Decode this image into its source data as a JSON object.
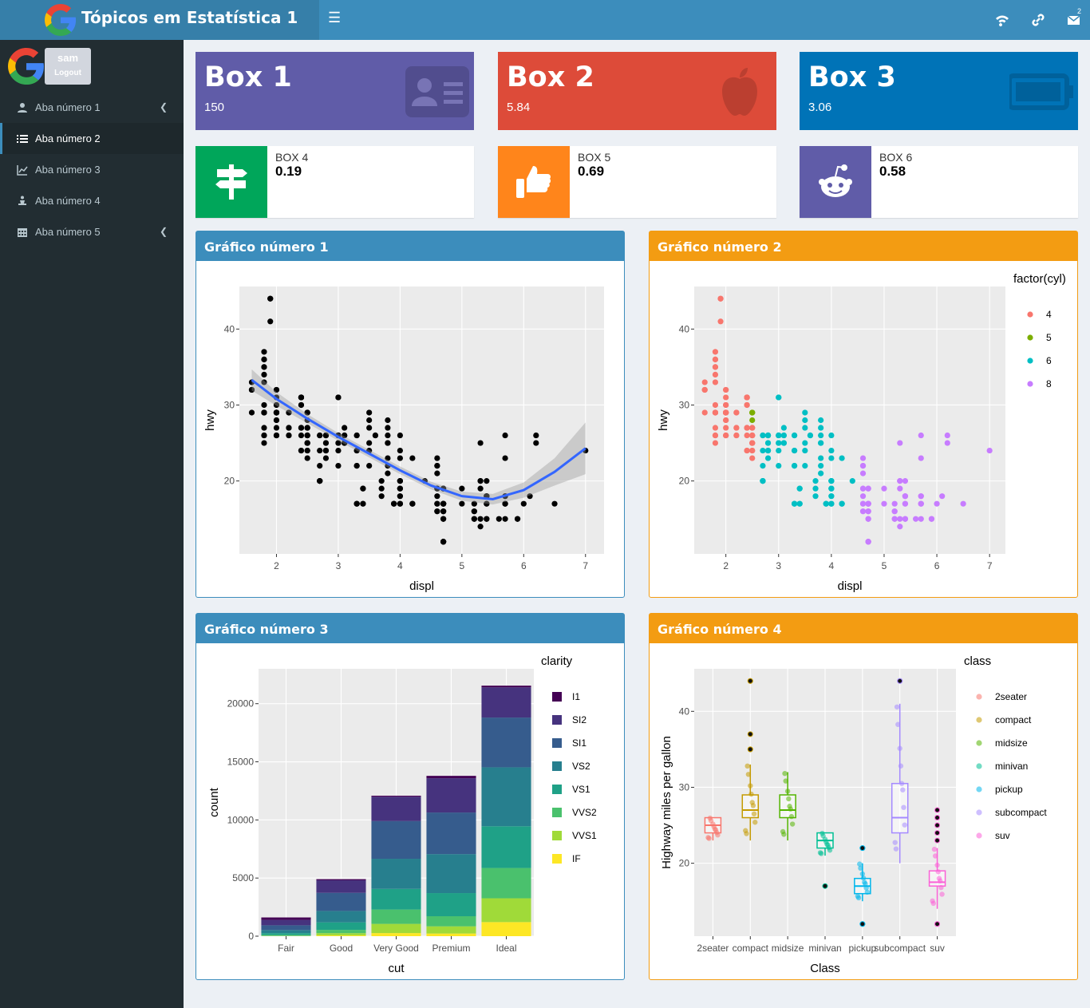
{
  "app": {
    "title": "Tópicos em Estatística 1",
    "notif_count": "2"
  },
  "user": {
    "name": "sam",
    "logout": "Logout"
  },
  "sidebar": {
    "items": [
      {
        "label": "Aba número 1",
        "icon": "user-icon",
        "active": false,
        "chevron": true
      },
      {
        "label": "Aba número 2",
        "icon": "list-icon",
        "active": true,
        "chevron": false
      },
      {
        "label": "Aba número 3",
        "icon": "line-chart-icon",
        "active": false,
        "chevron": false
      },
      {
        "label": "Aba número 4",
        "icon": "meditation-icon",
        "active": false,
        "chevron": false
      },
      {
        "label": "Aba número 5",
        "icon": "calendar-icon",
        "active": false,
        "chevron": true
      }
    ]
  },
  "value_boxes": [
    {
      "title": "Box 1",
      "value": "150",
      "color": "#605ca8",
      "icon": "id-card-icon"
    },
    {
      "title": "Box 2",
      "value": "5.84",
      "color": "#dd4b39",
      "icon": "apple-icon"
    },
    {
      "title": "Box 3",
      "value": "3.06",
      "color": "#0073b7",
      "icon": "battery-icon"
    }
  ],
  "info_boxes": [
    {
      "label": "BOX 4",
      "value": "0.19",
      "color": "#00a65a",
      "icon": "signpost-icon"
    },
    {
      "label": "BOX 5",
      "value": "0.69",
      "color": "#ff851b",
      "icon": "thumbs-up-icon"
    },
    {
      "label": "BOX 6",
      "value": "0.58",
      "color": "#605ca8",
      "icon": "reddit-icon"
    }
  ],
  "panels": [
    {
      "title": "Gráfico número 1"
    },
    {
      "title": "Gráfico número 2"
    },
    {
      "title": "Gráfico número 3"
    },
    {
      "title": "Gráfico número 4"
    }
  ],
  "chart_data": [
    {
      "type": "scatter",
      "xlabel": "displ",
      "ylabel": "hwy",
      "xlim": [
        1.4,
        7.3
      ],
      "ylim": [
        10.4,
        45.6
      ],
      "xticks": [
        2,
        3,
        4,
        5,
        6,
        7
      ],
      "yticks": [
        20,
        30,
        40
      ],
      "grid": true,
      "points": [
        [
          1.8,
          29
        ],
        [
          1.8,
          29
        ],
        [
          2,
          31
        ],
        [
          2,
          30
        ],
        [
          2.8,
          26
        ],
        [
          2.8,
          26
        ],
        [
          3.1,
          27
        ],
        [
          1.8,
          26
        ],
        [
          1.8,
          25
        ],
        [
          2,
          28
        ],
        [
          2,
          27
        ],
        [
          2.8,
          25
        ],
        [
          2.8,
          25
        ],
        [
          3.1,
          25
        ],
        [
          3.1,
          25
        ],
        [
          2.8,
          24
        ],
        [
          3.1,
          25
        ],
        [
          4.2,
          23
        ],
        [
          5.3,
          20
        ],
        [
          5.3,
          15
        ],
        [
          5.3,
          20
        ],
        [
          5.7,
          17
        ],
        [
          6,
          17
        ],
        [
          5.7,
          26
        ],
        [
          5.7,
          23
        ],
        [
          6.2,
          26
        ],
        [
          6.2,
          25
        ],
        [
          7,
          24
        ],
        [
          5.3,
          19
        ],
        [
          5.3,
          14
        ],
        [
          5.7,
          15
        ],
        [
          6.5,
          17
        ],
        [
          2.4,
          27
        ],
        [
          2.4,
          30
        ],
        [
          3.1,
          26
        ],
        [
          3.5,
          29
        ],
        [
          3.6,
          26
        ],
        [
          2.4,
          24
        ],
        [
          3,
          24
        ],
        [
          3.3,
          22
        ],
        [
          3.3,
          22
        ],
        [
          3.3,
          24
        ],
        [
          3.3,
          24
        ],
        [
          3.3,
          17
        ],
        [
          3.8,
          22
        ],
        [
          3.8,
          21
        ],
        [
          3.8,
          23
        ],
        [
          4,
          23
        ],
        [
          3.7,
          19
        ],
        [
          3.7,
          18
        ],
        [
          3.9,
          17
        ],
        [
          3.9,
          17
        ],
        [
          4.7,
          19
        ],
        [
          4.7,
          19
        ],
        [
          4.7,
          12
        ],
        [
          5.2,
          17
        ],
        [
          5.2,
          15
        ],
        [
          3.9,
          17
        ],
        [
          4.7,
          17
        ],
        [
          4.7,
          12
        ],
        [
          4.7,
          17
        ],
        [
          5.2,
          16
        ],
        [
          5.7,
          18
        ],
        [
          5.9,
          15
        ],
        [
          4.7,
          16
        ],
        [
          4.7,
          12
        ],
        [
          4.7,
          17
        ],
        [
          4.7,
          17
        ],
        [
          4.7,
          16
        ],
        [
          4.7,
          12
        ],
        [
          5.2,
          15
        ],
        [
          5.2,
          16
        ],
        [
          5.7,
          17
        ],
        [
          5.9,
          15
        ],
        [
          4.6,
          17
        ],
        [
          5.4,
          17
        ],
        [
          5.4,
          18
        ],
        [
          4,
          17
        ],
        [
          4,
          19
        ],
        [
          4,
          17
        ],
        [
          4,
          19
        ],
        [
          4.6,
          19
        ],
        [
          5,
          17
        ],
        [
          4.2,
          17
        ],
        [
          4.2,
          17
        ],
        [
          4.6,
          16
        ],
        [
          4.6,
          16
        ],
        [
          4.6,
          17
        ],
        [
          5.4,
          15
        ],
        [
          5.4,
          17
        ],
        [
          3.8,
          26
        ],
        [
          3.8,
          25
        ],
        [
          4,
          26
        ],
        [
          4,
          24
        ],
        [
          4.6,
          21
        ],
        [
          4.6,
          22
        ],
        [
          4.6,
          23
        ],
        [
          4.6,
          22
        ],
        [
          5.4,
          20
        ],
        [
          1.6,
          33
        ],
        [
          1.6,
          32
        ],
        [
          1.6,
          32
        ],
        [
          1.6,
          29
        ],
        [
          1.6,
          32
        ],
        [
          1.8,
          34
        ],
        [
          1.8,
          36
        ],
        [
          1.8,
          36
        ],
        [
          2,
          29
        ],
        [
          2.4,
          26
        ],
        [
          2.4,
          27
        ],
        [
          2.4,
          30
        ],
        [
          2.4,
          31
        ],
        [
          2.5,
          26
        ],
        [
          2.5,
          26
        ],
        [
          3.3,
          26
        ],
        [
          2,
          32
        ],
        [
          2,
          30
        ],
        [
          2,
          32
        ],
        [
          2,
          29
        ],
        [
          2.7,
          26
        ],
        [
          2.7,
          24
        ],
        [
          2.7,
          26
        ],
        [
          3,
          22
        ],
        [
          3.7,
          20
        ],
        [
          4,
          17
        ],
        [
          4.7,
          12
        ],
        [
          4.7,
          15
        ],
        [
          4.7,
          16
        ],
        [
          5.7,
          17
        ],
        [
          6.1,
          18
        ],
        [
          4,
          20
        ],
        [
          4.2,
          17
        ],
        [
          4.4,
          20
        ],
        [
          4.6,
          18
        ],
        [
          5.4,
          18
        ],
        [
          5.4,
          15
        ],
        [
          5.4,
          18
        ],
        [
          4,
          20
        ],
        [
          4,
          18
        ],
        [
          4.6,
          19
        ],
        [
          5,
          19
        ],
        [
          2.4,
          24
        ],
        [
          2.4,
          27
        ],
        [
          2.5,
          25
        ],
        [
          2.5,
          24
        ],
        [
          3.5,
          24
        ],
        [
          3.5,
          25
        ],
        [
          3,
          25
        ],
        [
          3,
          25
        ],
        [
          3.5,
          22
        ],
        [
          3.3,
          17
        ],
        [
          3.3,
          17
        ],
        [
          4,
          19
        ],
        [
          5.6,
          15
        ],
        [
          3.1,
          26
        ],
        [
          3.8,
          25
        ],
        [
          3.8,
          28
        ],
        [
          3.8,
          27
        ],
        [
          5.3,
          25
        ],
        [
          2.5,
          25
        ],
        [
          2.5,
          24
        ],
        [
          2.5,
          27
        ],
        [
          2.5,
          25
        ],
        [
          2.5,
          26
        ],
        [
          2.5,
          23
        ],
        [
          2.2,
          26
        ],
        [
          2.2,
          26
        ],
        [
          2.5,
          26
        ],
        [
          2.5,
          26
        ],
        [
          2.5,
          25
        ],
        [
          2.5,
          27
        ],
        [
          2.5,
          25
        ],
        [
          2.5,
          27
        ],
        [
          2.7,
          20
        ],
        [
          2.7,
          20
        ],
        [
          3.4,
          19
        ],
        [
          3.4,
          17
        ],
        [
          4,
          20
        ],
        [
          4.7,
          17
        ],
        [
          2.2,
          29
        ],
        [
          2.2,
          27
        ],
        [
          2.4,
          31
        ],
        [
          2.4,
          31
        ],
        [
          3,
          26
        ],
        [
          3,
          26
        ],
        [
          3.5,
          28
        ],
        [
          2.2,
          27
        ],
        [
          2.2,
          29
        ],
        [
          2.4,
          31
        ],
        [
          2.4,
          31
        ],
        [
          3,
          26
        ],
        [
          3,
          26
        ],
        [
          3.5,
          27
        ],
        [
          3,
          31
        ],
        [
          3,
          31
        ],
        [
          3.3,
          26
        ],
        [
          1.8,
          26
        ],
        [
          1.8,
          27
        ],
        [
          1.8,
          30
        ],
        [
          1.8,
          33
        ],
        [
          1.8,
          35
        ],
        [
          1.8,
          37
        ],
        [
          1.8,
          35
        ],
        [
          4.7,
          15
        ],
        [
          5.7,
          18
        ],
        [
          2.7,
          20
        ],
        [
          2.7,
          20
        ],
        [
          2.7,
          22
        ],
        [
          3.4,
          17
        ],
        [
          3.4,
          19
        ],
        [
          4,
          18
        ],
        [
          4,
          20
        ],
        [
          2,
          29
        ],
        [
          2,
          26
        ],
        [
          2,
          29
        ],
        [
          2,
          29
        ],
        [
          2.8,
          24
        ],
        [
          1.9,
          44
        ],
        [
          2,
          29
        ],
        [
          2,
          26
        ],
        [
          2,
          29
        ],
        [
          2,
          29
        ],
        [
          2.5,
          29
        ],
        [
          2.5,
          29
        ],
        [
          2.8,
          23
        ],
        [
          2.8,
          24
        ],
        [
          1.9,
          44
        ],
        [
          1.9,
          41
        ],
        [
          2,
          29
        ],
        [
          2,
          26
        ],
        [
          2.5,
          28
        ],
        [
          2.5,
          29
        ],
        [
          1.8,
          29
        ],
        [
          1.8,
          29
        ],
        [
          2,
          28
        ],
        [
          2,
          29
        ],
        [
          2.8,
          26
        ],
        [
          2.8,
          26
        ],
        [
          3.6,
          26
        ]
      ],
      "smooth": [
        [
          1.6,
          33.3
        ],
        [
          2,
          30.8
        ],
        [
          2.5,
          28.2
        ],
        [
          3,
          25.8
        ],
        [
          3.5,
          23.6
        ],
        [
          4,
          21.4
        ],
        [
          4.5,
          19.4
        ],
        [
          5,
          18
        ],
        [
          5.5,
          17.6
        ],
        [
          6,
          18.8
        ],
        [
          6.5,
          21.2
        ],
        [
          7,
          24.3
        ]
      ],
      "band_width": [
        1.4,
        0.9,
        0.6,
        0.5,
        0.5,
        0.5,
        0.5,
        0.6,
        0.7,
        1,
        1.8,
        3.4
      ]
    },
    {
      "type": "scatter",
      "xlabel": "displ",
      "ylabel": "hwy",
      "legend_title": "factor(cyl)",
      "legend": [
        "4",
        "5",
        "6",
        "8"
      ],
      "colors": [
        "#f8766d",
        "#7cae00",
        "#00bfc4",
        "#c77cff"
      ],
      "xlim": [
        1.4,
        7.3
      ],
      "ylim": [
        10.4,
        45.6
      ],
      "xticks": [
        2,
        3,
        4,
        5,
        6,
        7
      ],
      "yticks": [
        20,
        30,
        40
      ],
      "cyl_rule": "by engine"
    },
    {
      "type": "bar",
      "stacked": true,
      "xlabel": "cut",
      "ylabel": "count",
      "legend_title": "clarity",
      "categories": [
        "Fair",
        "Good",
        "Very Good",
        "Premium",
        "Ideal"
      ],
      "ylim": [
        0,
        23000
      ],
      "yticks": [
        0,
        5000,
        10000,
        15000,
        20000
      ],
      "series": [
        {
          "name": "I1",
          "color": "#440154",
          "values": [
            210,
            96,
            84,
            205,
            146
          ]
        },
        {
          "name": "SI2",
          "color": "#46337e",
          "values": [
            466,
            1081,
            2100,
            2949,
            2598
          ]
        },
        {
          "name": "SI1",
          "color": "#365c8d",
          "values": [
            408,
            1560,
            3240,
            3575,
            4282
          ]
        },
        {
          "name": "VS2",
          "color": "#277f8e",
          "values": [
            261,
            978,
            2591,
            3357,
            5071
          ]
        },
        {
          "name": "VS1",
          "color": "#1fa187",
          "values": [
            170,
            648,
            1775,
            1989,
            3589
          ]
        },
        {
          "name": "VVS2",
          "color": "#4ac16d",
          "values": [
            69,
            286,
            1235,
            870,
            2606
          ]
        },
        {
          "name": "VVS1",
          "color": "#a0da39",
          "values": [
            17,
            186,
            789,
            616,
            2047
          ]
        },
        {
          "name": "IF",
          "color": "#fde725",
          "values": [
            9,
            71,
            268,
            230,
            1212
          ]
        }
      ]
    },
    {
      "type": "box",
      "xlabel": "Class",
      "ylabel": "Highway miles per gallon",
      "legend_title": "class",
      "categories": [
        "2seater",
        "compact",
        "midsize",
        "minivan",
        "pickup",
        "subcompact",
        "suv"
      ],
      "colors": [
        "#f8766d",
        "#c49a00",
        "#53b400",
        "#00c094",
        "#00b6eb",
        "#a58aff",
        "#fb61d7"
      ],
      "ylim": [
        10.4,
        45.6
      ],
      "yticks": [
        20,
        30,
        40
      ],
      "boxes": [
        {
          "min": 23,
          "q1": 24,
          "med": 25,
          "q3": 26,
          "max": 26,
          "out": []
        },
        {
          "min": 23,
          "q1": 26,
          "med": 27,
          "q3": 29,
          "max": 33,
          "out": [
            35,
            35,
            37,
            44,
            44
          ]
        },
        {
          "min": 23,
          "q1": 26,
          "med": 27,
          "q3": 29,
          "max": 32,
          "out": []
        },
        {
          "min": 21,
          "q1": 22,
          "med": 23,
          "q3": 24,
          "max": 24,
          "out": [
            17
          ]
        },
        {
          "min": 15,
          "q1": 16,
          "med": 17,
          "q3": 18,
          "max": 20,
          "out": [
            12,
            12,
            22,
            22
          ]
        },
        {
          "min": 20,
          "q1": 24,
          "med": 26,
          "q3": 30.5,
          "max": 41,
          "out": [
            44,
            44
          ]
        },
        {
          "min": 14,
          "q1": 17,
          "med": 17.5,
          "q3": 19,
          "max": 22,
          "out": [
            12,
            12,
            23,
            24,
            25,
            26,
            27
          ]
        }
      ]
    }
  ]
}
